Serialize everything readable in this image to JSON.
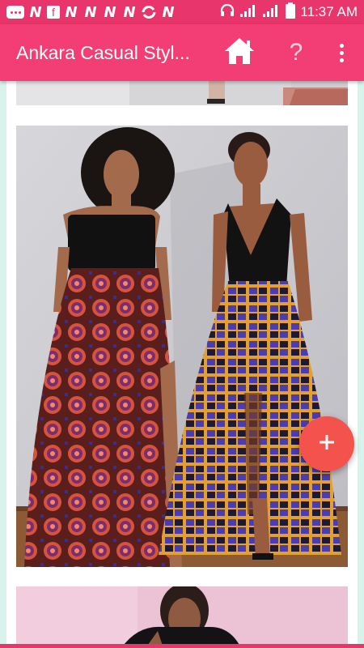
{
  "status_bar": {
    "time": "11:37 AM",
    "notification_letters": [
      "N",
      "N",
      "N",
      "N",
      "N",
      "N"
    ],
    "icons": [
      "message-icon",
      "facebook-icon",
      "headset-icon",
      "signal-icon",
      "battery-icon"
    ]
  },
  "app_bar": {
    "title": "Ankara Casual Styl...",
    "home_icon": "home-icon",
    "help_label": "?",
    "more_icon": "more-vert-icon"
  },
  "gallery": {
    "items": [
      {
        "name": "ankara-style-photo-1",
        "visibility": "partially visible (top cropped)"
      },
      {
        "name": "ankara-style-photo-2",
        "visibility": "fully visible"
      },
      {
        "name": "ankara-style-photo-3",
        "visibility": "partially visible (bottom cropped)"
      }
    ]
  },
  "fab": {
    "label": "+",
    "icon": "add-icon"
  },
  "colors": {
    "app_bar": "#f23e74",
    "status_bar": "#e8356b",
    "fab": "#f4524d",
    "background": "#d9f2ec"
  }
}
